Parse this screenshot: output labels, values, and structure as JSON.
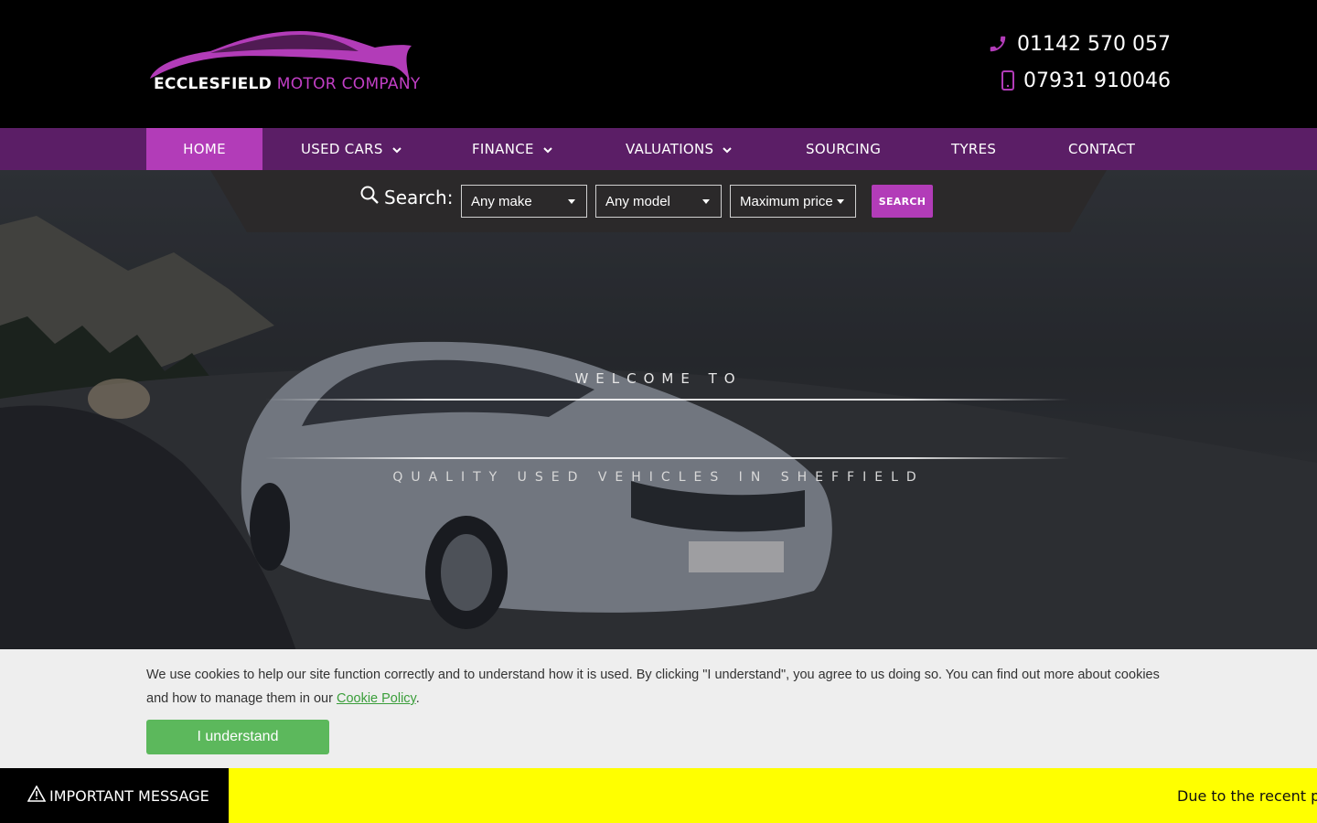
{
  "brand": {
    "name_bold": "ECCLESFIELD",
    "name_light": "MOTOR COMPANY",
    "accent": "#b23cb8",
    "nav_bg": "#5b1e66"
  },
  "header": {
    "phone_landline": "01142 570 057",
    "phone_mobile": "07931 910046",
    "icons": [
      "phone-icon",
      "mobile-phone-icon"
    ]
  },
  "nav": {
    "items": [
      {
        "label": "HOME",
        "active": true,
        "dropdown": false
      },
      {
        "label": "USED CARS",
        "active": false,
        "dropdown": true
      },
      {
        "label": "FINANCE",
        "active": false,
        "dropdown": true
      },
      {
        "label": "VALUATIONS",
        "active": false,
        "dropdown": true
      },
      {
        "label": "SOURCING",
        "active": false,
        "dropdown": false
      },
      {
        "label": "TYRES",
        "active": false,
        "dropdown": false
      },
      {
        "label": "CONTACT",
        "active": false,
        "dropdown": false
      }
    ]
  },
  "search": {
    "label": "Search:",
    "make": "Any make",
    "model": "Any model",
    "price": "Maximum price",
    "button": "SEARCH"
  },
  "hero": {
    "welcome": "WELCOME TO",
    "tagline": "QUALITY USED VEHICLES IN SHEFFIELD"
  },
  "cookie": {
    "text": "We use cookies to help our site function correctly and to understand how it is used. By clicking \"I understand\", you agree to us doing so. You can find out more about cookies and how to manage them in our ",
    "link": "Cookie Policy",
    "suffix": ".",
    "button": "I understand"
  },
  "important": {
    "label": "IMPORTANT MESSAGE",
    "ticker": "Due to the recent pa"
  }
}
